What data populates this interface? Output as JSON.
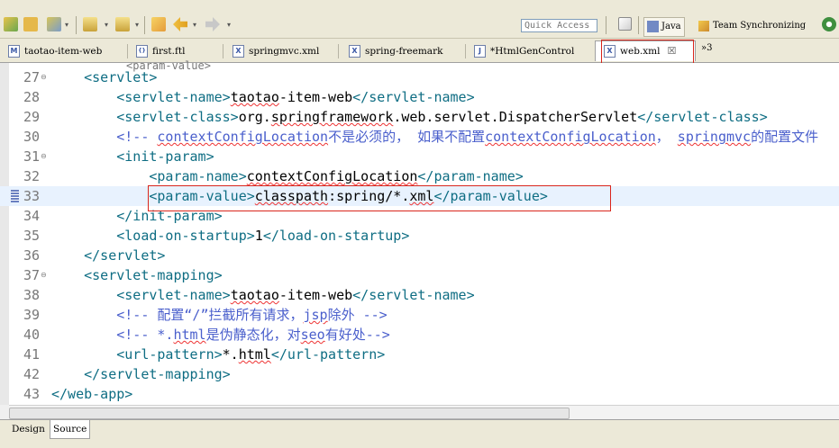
{
  "toolbar": {
    "quick_access_placeholder": "Quick Access",
    "perspectives": [
      {
        "label": "Java",
        "active": true
      },
      {
        "label": "Team Synchronizing",
        "active": false
      }
    ]
  },
  "tabs": [
    {
      "label": "taotao-item-web",
      "icon": "M",
      "active": false
    },
    {
      "label": "first.ftl",
      "icon": "{}",
      "active": false
    },
    {
      "label": "springmvc.xml",
      "icon": "X",
      "active": false
    },
    {
      "label": "spring-freemark",
      "icon": "X",
      "active": false
    },
    {
      "label": "*HtmlGenControl",
      "icon": "J",
      "active": false
    },
    {
      "label": "web.xml",
      "icon": "X",
      "active": true
    }
  ],
  "tab_overflow": "»3",
  "editor": {
    "lines": [
      {
        "num": "27",
        "text": "    <servlet>",
        "fold": true
      },
      {
        "num": "28",
        "text": "        <servlet-name>taotao-item-web</servlet-name>"
      },
      {
        "num": "29",
        "text": "        <servlet-class>org.springframework.web.servlet.DispatcherServlet</servlet-class>"
      },
      {
        "num": "30",
        "text": "        <!-- contextConfigLocation不是必须的， 如果不配置contextConfigLocation， springmvc的配置文件"
      },
      {
        "num": "31",
        "text": "        <init-param>",
        "fold": true
      },
      {
        "num": "32",
        "text": "            <param-name>contextConfigLocation</param-name>"
      },
      {
        "num": "33",
        "text": "            <param-value>classpath:spring/*.xml</param-value>",
        "current": true
      },
      {
        "num": "34",
        "text": "        </init-param>"
      },
      {
        "num": "35",
        "text": "        <load-on-startup>1</load-on-startup>"
      },
      {
        "num": "36",
        "text": "    </servlet>"
      },
      {
        "num": "37",
        "text": "    <servlet-mapping>",
        "fold": true
      },
      {
        "num": "38",
        "text": "        <servlet-name>taotao-item-web</servlet-name>"
      },
      {
        "num": "39",
        "text": "        <!-- 配置“/”拦截所有请求，jsp除外 -->"
      },
      {
        "num": "40",
        "text": "        <!-- *.html是伪静态化，对seo有好处-->"
      },
      {
        "num": "41",
        "text": "        <url-pattern>*.html</url-pattern>"
      },
      {
        "num": "42",
        "text": "    </servlet-mapping>"
      },
      {
        "num": "43",
        "text": "</web-app>"
      }
    ]
  },
  "bottom_tabs": [
    {
      "label": "Design",
      "active": false
    },
    {
      "label": "Source",
      "active": true
    }
  ],
  "colors": {
    "tag": "#0e6d83",
    "comment": "#4a5fcc",
    "highlight_box": "#d9261c"
  }
}
